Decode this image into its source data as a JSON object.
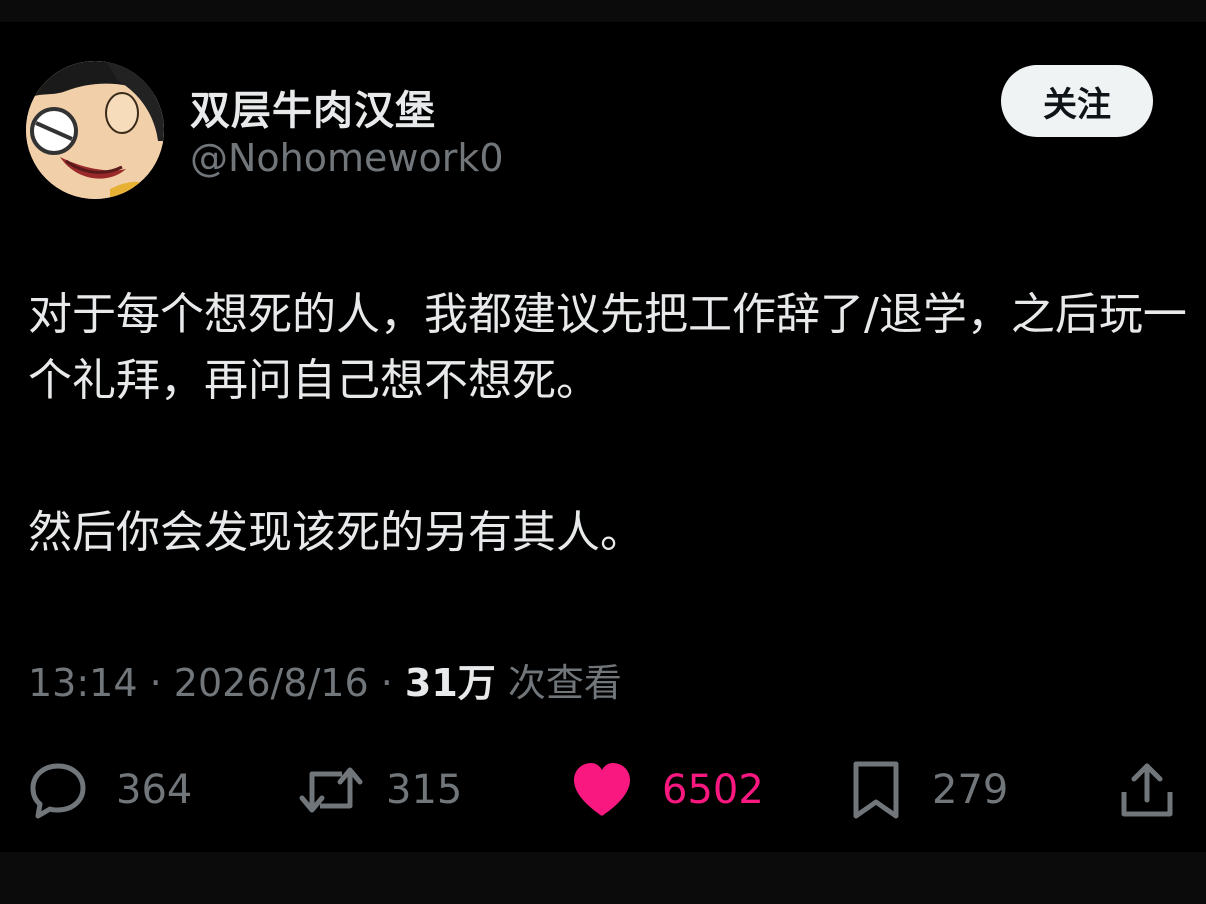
{
  "author": {
    "display_name": "双层牛肉汉堡",
    "handle": "@Nohomework0",
    "avatar_icon": "cartoon-avatar"
  },
  "follow_button": {
    "label": "关注"
  },
  "tweet": {
    "paragraphs": [
      "对于每个想死的人，我都建议先把工作辞了/退学，之后玩一个礼拜，再问自己想不想死。",
      "然后你会发现该死的另有其人。"
    ]
  },
  "meta": {
    "time": "13:14",
    "separator": "·",
    "date": "2026/8/16",
    "views_count": "31万",
    "views_label": "次查看"
  },
  "actions": {
    "reply": {
      "icon": "reply-icon",
      "count": "364"
    },
    "retweet": {
      "icon": "retweet-icon",
      "count": "315"
    },
    "like": {
      "icon": "heart-icon",
      "count": "6502",
      "liked": true
    },
    "bookmark": {
      "icon": "bookmark-icon",
      "count": "279"
    },
    "share": {
      "icon": "share-icon"
    }
  },
  "colors": {
    "background": "#000000",
    "text_primary": "#e7e9ea",
    "text_secondary": "#71767b",
    "like_accent": "#f91880",
    "follow_button_bg": "#eff3f4"
  }
}
